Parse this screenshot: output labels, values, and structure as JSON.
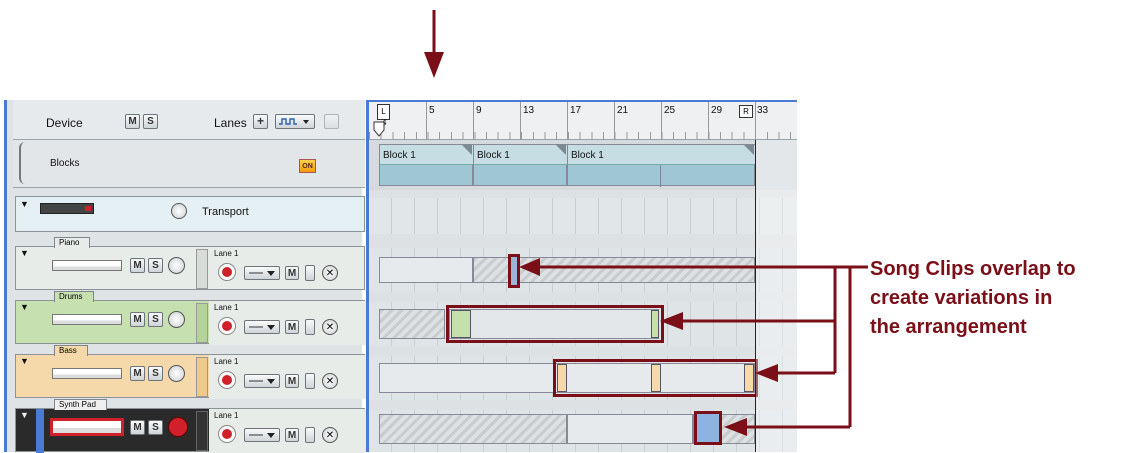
{
  "device_header": {
    "device_label": "Device",
    "mute": "M",
    "solo": "S",
    "lanes_label": "Lanes",
    "add": "+"
  },
  "blocks_row": {
    "label": "Blocks",
    "on_badge": "ON"
  },
  "transport": {
    "label": "Transport"
  },
  "tracks": [
    {
      "name": "Piano",
      "lane": "Lane 1",
      "color": "#e8ece8"
    },
    {
      "name": "Drums",
      "lane": "Lane 1",
      "color": "#c6e0b0"
    },
    {
      "name": "Bass",
      "lane": "Lane 1",
      "color": "#f5d9aa"
    },
    {
      "name": "Synth Pad",
      "lane": "Lane 1",
      "color": "#1c1c1c"
    }
  ],
  "buttons": {
    "mute": "M",
    "solo": "S"
  },
  "ruler": {
    "bars": [
      "5",
      "9",
      "13",
      "17",
      "21",
      "25",
      "29",
      "33"
    ],
    "left_locator": "L",
    "right_locator": "R",
    "left_sub": "4"
  },
  "block_clips": [
    "Block 1",
    "Block 1",
    "Block 1"
  ],
  "annotation": {
    "line1": "Song Clips overlap to",
    "line2": "create variations in",
    "line3": "the arrangement"
  },
  "colors": {
    "annotation": "#7a0f18",
    "accent_blue": "#4a7bd4",
    "block_teal": "#9ec7d3"
  }
}
